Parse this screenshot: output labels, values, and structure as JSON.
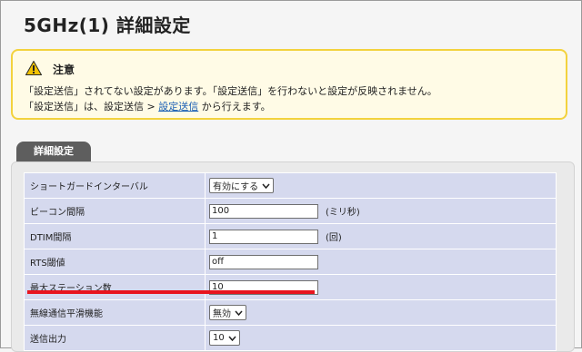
{
  "page": {
    "title": "5GHz(1) 詳細設定"
  },
  "notice": {
    "title": "注意",
    "line1": "「設定送信」されてない設定があります。「設定送信」を行わないと設定が反映されません。",
    "line2_prefix": "「設定送信」は、設定送信 > ",
    "line2_link": "設定送信",
    "line2_suffix": " から行えます。",
    "icon": "warning-icon",
    "accent_color": "#f3d23d"
  },
  "section": {
    "tab_label": "詳細設定"
  },
  "settings": {
    "rows": [
      {
        "label": "ショートガードインターバル",
        "type": "select",
        "value": "有効にする",
        "unit": ""
      },
      {
        "label": "ビーコン間隔",
        "type": "text",
        "value": "100",
        "unit": "(ミリ秒)"
      },
      {
        "label": "DTIM間隔",
        "type": "text",
        "value": "1",
        "unit": "(回)"
      },
      {
        "label": "RTS閾値",
        "type": "text",
        "value": "off",
        "unit": ""
      },
      {
        "label": "最大ステーション数",
        "type": "text",
        "value": "10",
        "unit": ""
      },
      {
        "label": "無線通信平滑機能",
        "type": "select",
        "value": "無効",
        "unit": ""
      },
      {
        "label": "送信出力",
        "type": "select",
        "value": "10",
        "unit": ""
      }
    ]
  },
  "highlight": {
    "color": "#e8141e"
  }
}
